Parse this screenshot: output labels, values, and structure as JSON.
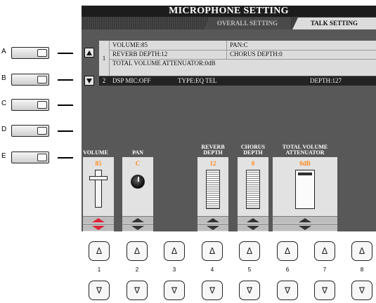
{
  "side_buttons": [
    "A",
    "B",
    "C",
    "D",
    "E"
  ],
  "screen": {
    "title": "MICROPHONE SETTING",
    "tabs": [
      {
        "label": "OVERALL SETTING",
        "active": false
      },
      {
        "label": "TALK SETTING",
        "active": true
      }
    ],
    "list": {
      "row1": {
        "number": "1",
        "volume": "VOLUME:85",
        "pan": "PAN:C",
        "reverb_depth": "REVERB DEPTH:12",
        "chorus_depth": "CHORUS DEPTH:0",
        "total_volume_attenuator": "TOTAL VOLUME ATTENUATOR:0dB"
      },
      "row2": {
        "number": "2",
        "dsp_mic": "DSP MIC:OFF",
        "type": "TYPE:EQ TEL",
        "depth": "DEPTH:127"
      }
    },
    "controls": {
      "volume": {
        "label": "VOLUME",
        "value": "85"
      },
      "pan": {
        "label": "PAN",
        "value": "C"
      },
      "reverb": {
        "label_line1": "REVERB",
        "label_line2": "DEPTH",
        "value": "12"
      },
      "chorus": {
        "label_line1": "CHORUS",
        "label_line2": "DEPTH",
        "value": "0"
      },
      "attenuator": {
        "label_line1": "TOTAL VOLUME",
        "label_line2": "ATTENUATOR",
        "value": "0dB"
      }
    },
    "colors": {
      "value_text": "#ff8a1a",
      "selected_arrow": "#e0203a",
      "screen_bg": "#585858"
    }
  },
  "bottom_buttons": {
    "numbers": [
      "1",
      "2",
      "3",
      "4",
      "5",
      "6",
      "7",
      "8"
    ],
    "up_glyph": "Δ",
    "down_glyph": "∇"
  }
}
